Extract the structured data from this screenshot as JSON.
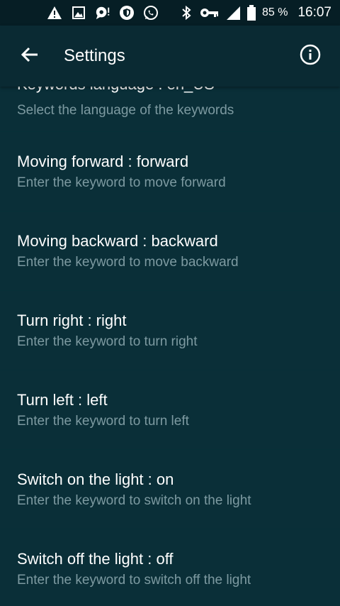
{
  "status_bar": {
    "left_icons": [
      "warning-icon",
      "image-icon",
      "chat-alert-icon",
      "shield-icon",
      "whatsapp-icon"
    ],
    "right_icons": [
      "bluetooth-icon",
      "key-icon",
      "signal-icon",
      "battery-icon"
    ],
    "battery": "85 %",
    "time": "16:07"
  },
  "app_bar": {
    "title": "Settings",
    "back_icon": "arrow-back-icon",
    "info_icon": "info-icon"
  },
  "settings": {
    "partial_item": {
      "title": "Keywords language : en_US",
      "subtitle": "Select the language of the keywords"
    },
    "items": [
      {
        "title": "Moving forward : forward",
        "subtitle": "Enter the keyword to move forward"
      },
      {
        "title": "Moving backward : backward",
        "subtitle": "Enter the keyword to move backward"
      },
      {
        "title": "Turn right : right",
        "subtitle": "Enter the keyword to turn right"
      },
      {
        "title": "Turn left : left",
        "subtitle": "Enter the keyword to turn left"
      },
      {
        "title": "Switch on the light : on",
        "subtitle": "Enter the keyword to switch on the light"
      },
      {
        "title": "Switch off the light : off",
        "subtitle": "Enter the keyword to switch off the light"
      }
    ]
  },
  "colors": {
    "background": "#0a2f38",
    "app_bar": "#0a2a33",
    "status_bar": "#061e25",
    "subtitle": "#7d9aa1"
  }
}
